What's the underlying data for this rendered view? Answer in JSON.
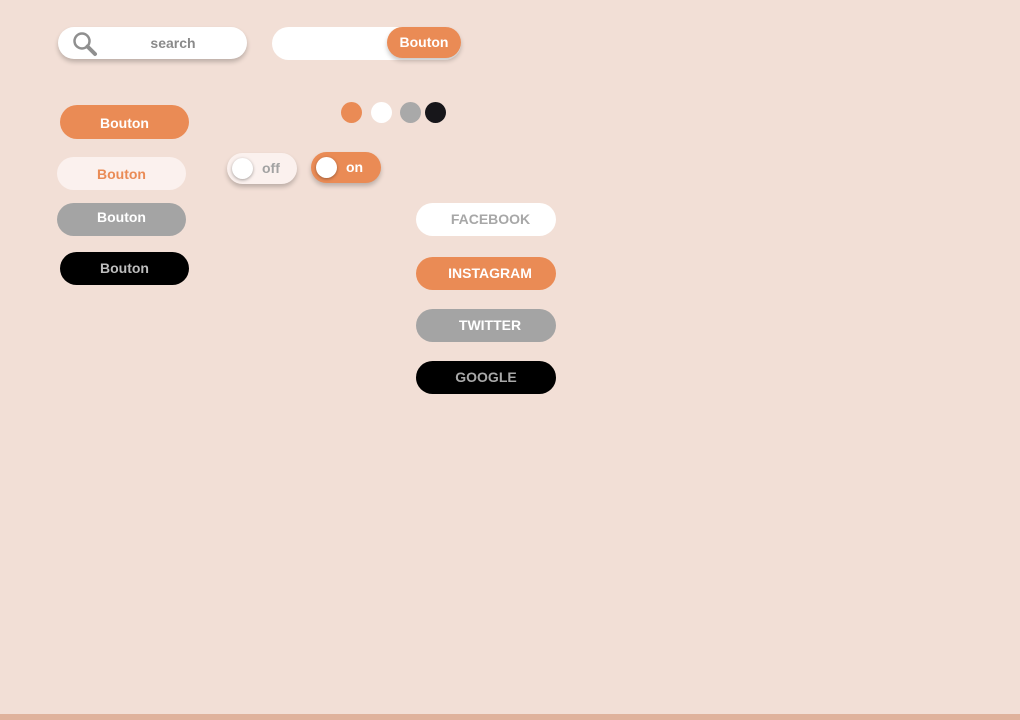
{
  "search": {
    "placeholder": "search",
    "icon": "search-icon"
  },
  "combo": {
    "button_label": "Bouton"
  },
  "buttons": [
    {
      "label": "Bouton",
      "style": "orange"
    },
    {
      "label": "Bouton",
      "style": "light"
    },
    {
      "label": "Bouton",
      "style": "gray"
    },
    {
      "label": "Bouton",
      "style": "black"
    }
  ],
  "swatches": [
    "#ea8b55",
    "#ffffff",
    "#a9a9a9",
    "#17161a"
  ],
  "toggles": {
    "off_label": "off",
    "on_label": "on"
  },
  "social": {
    "facebook": "FACEBOOK",
    "instagram": "INSTAGRAM",
    "twitter": "TWITTER",
    "google": "GOOGLE"
  },
  "colors": {
    "background": "#f2dfd6",
    "accent": "#ea8b55",
    "gray": "#a4a4a4",
    "black": "#000000"
  }
}
